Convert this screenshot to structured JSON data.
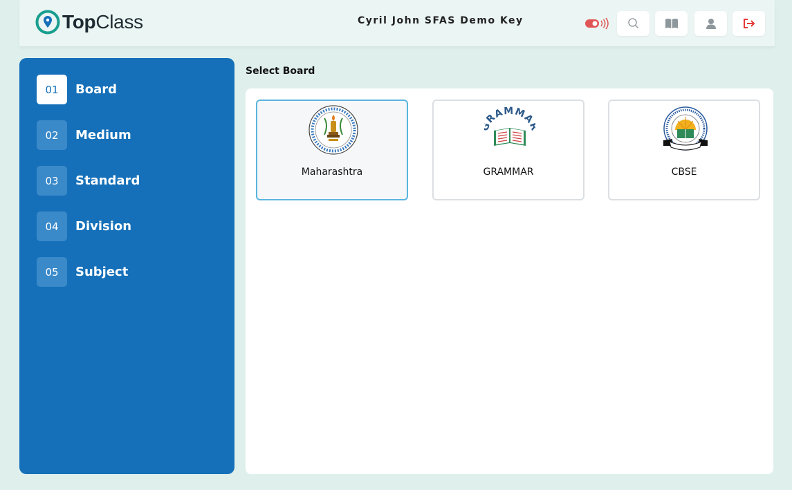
{
  "header": {
    "logo_bold": "Top",
    "logo_rest": "Class",
    "title": "Cyril John SFAS Demo Key",
    "icons": [
      "live-toggle-icon",
      "search-icon",
      "book-icon",
      "user-icon",
      "logout-icon"
    ]
  },
  "sidebar": {
    "steps": [
      {
        "num": "01",
        "label": "Board",
        "active": true
      },
      {
        "num": "02",
        "label": "Medium"
      },
      {
        "num": "03",
        "label": "Standard"
      },
      {
        "num": "04",
        "label": "Division"
      },
      {
        "num": "05",
        "label": "Subject"
      }
    ]
  },
  "main": {
    "section_title": "Select Board",
    "boards": [
      {
        "name": "Maharashtra",
        "selected": true
      },
      {
        "name": "GRAMMAR",
        "logo_text": "GRAMMAR"
      },
      {
        "name": "CBSE"
      }
    ]
  },
  "colors": {
    "accent": "#1570b9",
    "background": "#dff0ec",
    "logout": "#e53935",
    "live": "#e05555",
    "selected_border": "#5ab5dd"
  }
}
